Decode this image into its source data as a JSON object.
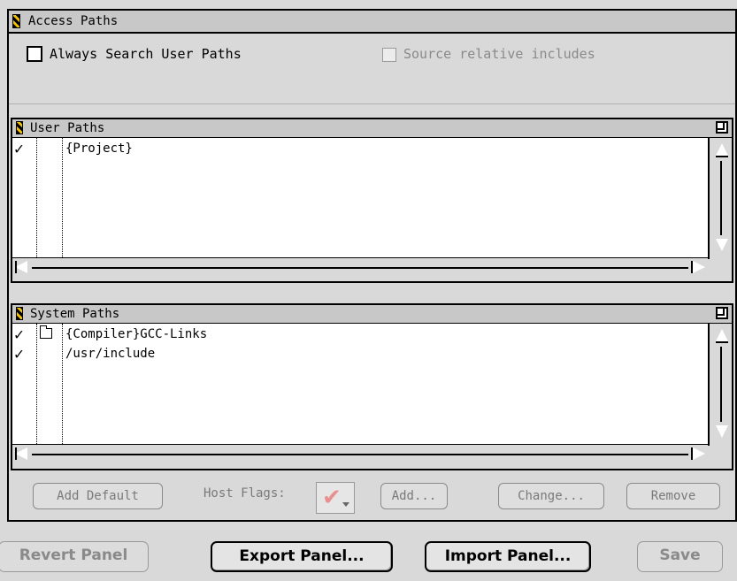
{
  "panel": {
    "title": "Access Paths"
  },
  "options": {
    "always_search_user_paths": {
      "label": "Always Search User Paths",
      "checked": false
    },
    "source_relative_includes": {
      "label": "Source relative includes",
      "checked": false,
      "enabled": false
    }
  },
  "user_paths": {
    "title": "User Paths",
    "rows": [
      {
        "checked": true,
        "folder": false,
        "path": "{Project}"
      }
    ]
  },
  "system_paths": {
    "title": "System Paths",
    "rows": [
      {
        "checked": true,
        "folder": true,
        "path": "{Compiler}GCC-Links"
      },
      {
        "checked": true,
        "folder": false,
        "path": "/usr/include"
      }
    ]
  },
  "actions": {
    "add_default": "Add Default",
    "host_flags_label": "Host Flags:",
    "add": "Add...",
    "change": "Change...",
    "remove": "Remove"
  },
  "footer": {
    "revert": "Revert Panel",
    "export": "Export Panel...",
    "import": "Import Panel...",
    "save": "Save"
  },
  "icons": {
    "check": "✓",
    "host_flag_check": "✔"
  },
  "colors": {
    "background": "#d9d9d9",
    "host_flag_check": "#e89090"
  }
}
